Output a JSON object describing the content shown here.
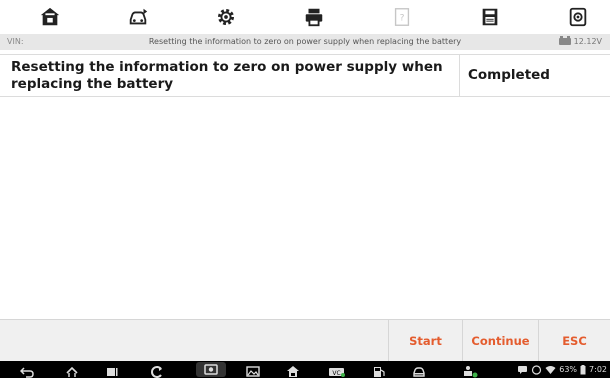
{
  "toolbar": {
    "icons": [
      "home-icon",
      "vehicle-swap-icon",
      "settings-icon",
      "print-icon",
      "help-icon",
      "save-icon",
      "screenshot-icon"
    ]
  },
  "subheader": {
    "vin_label": "VIN:",
    "title": "Resetting the information to zero on power supply when replacing the battery",
    "voltage": "12.12V"
  },
  "result": {
    "item": "Resetting the information to zero on power supply when replacing the battery",
    "status": "Completed"
  },
  "actions": {
    "start": "Start",
    "continue": "Continue",
    "esc": "ESC"
  },
  "statusbar": {
    "battery_percent": "63%",
    "time": "7:02"
  },
  "colors": {
    "accent": "#e45c2e",
    "subheader_bg": "#e7e7e7",
    "navbar_bg": "#000000"
  }
}
